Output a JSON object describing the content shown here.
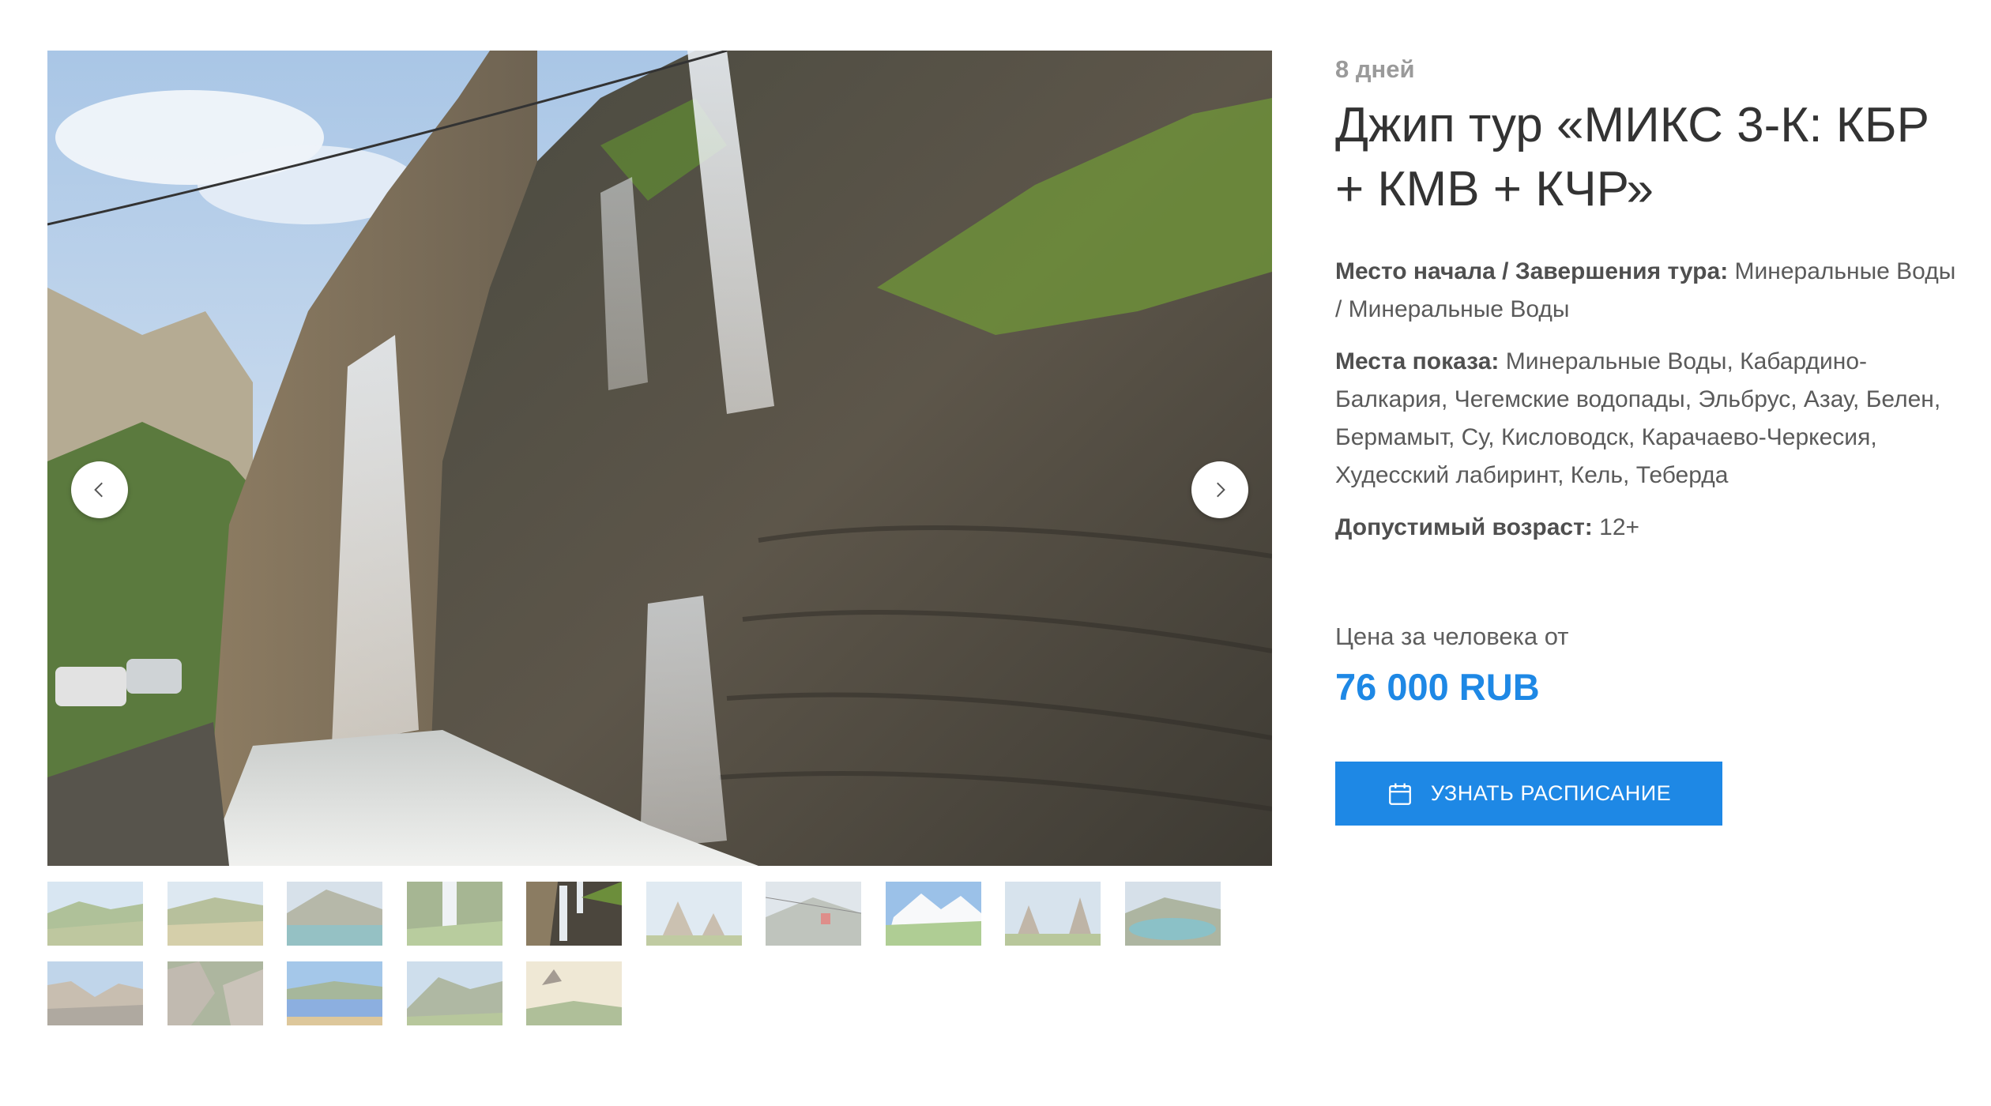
{
  "gallery": {
    "main_image": "chegem-waterfalls-photo",
    "prev_icon": "chevron-left-icon",
    "next_icon": "chevron-right-icon",
    "active_thumbnail_index": 4,
    "thumbnails": [
      "green-hills-photo",
      "valley-photo",
      "mountain-lake-photo",
      "waterfall-gorge-photo",
      "chegem-waterfalls-photo",
      "stone-towers-photo",
      "cable-car-photo",
      "elbrus-peaks-photo",
      "old-towers-photo",
      "turquoise-lake-photo",
      "canyon-photo",
      "rock-ruins-photo",
      "blue-lake-photo",
      "green-mountain-photo",
      "eagle-rock-photo"
    ]
  },
  "tour": {
    "duration": "8 дней",
    "title": "Джип тур «МИКС 3-К: КБР + КМВ + КЧР»",
    "start_end_label": "Место начала / Завершения тура:",
    "start_end_value": " Минеральные Воды / Минеральные Воды",
    "places_label": "Места показа:",
    "places_value": " Минеральные Воды, Кабардино-Балкария, Чегемские водопады, Эльбрус, Азау, Белен, Бермамыт, Су, Кисловодск, Карачаево-Черкесия, Худесский лабиринт, Кель, Теберда",
    "age_label": "Допустимый возраст:",
    "age_value": " 12+",
    "price_label": "Цена за человека от",
    "price": "76 000 RUB",
    "schedule_button": "УЗНАТЬ РАСПИСАНИЕ",
    "schedule_icon": "calendar-icon"
  },
  "colors": {
    "accent": "#1e88e5",
    "title_text": "#333333",
    "muted_text": "#9a9a9a"
  }
}
